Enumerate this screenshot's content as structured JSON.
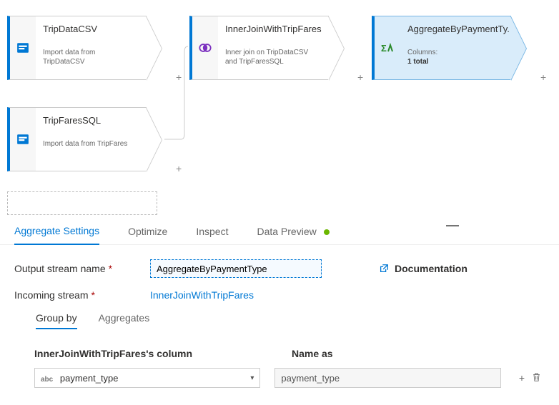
{
  "canvas": {
    "nodes": {
      "n1": {
        "title": "TripDataCSV",
        "sub": "Import data from TripDataCSV"
      },
      "n2": {
        "title": "InnerJoinWithTripFares",
        "sub": "Inner join on TripDataCSV and TripFaresSQL"
      },
      "n3": {
        "title": "AggregateByPaymentTy...",
        "sub_label": "Columns:",
        "sub_count": "1 total"
      },
      "n4": {
        "title": "TripFaresSQL",
        "sub": "Import data from TripFares"
      }
    },
    "plus": "+"
  },
  "tabs": {
    "t1": "Aggregate Settings",
    "t2": "Optimize",
    "t3": "Inspect",
    "t4": "Data Preview"
  },
  "settings": {
    "output_label": "Output stream name",
    "output_value": "AggregateByPaymentType",
    "incoming_label": "Incoming stream",
    "incoming_value": "InnerJoinWithTripFares",
    "doc": "Documentation"
  },
  "subtabs": {
    "s1": "Group by",
    "s2": "Aggregates"
  },
  "columns": {
    "col1_header": "InnerJoinWithTripFares's column",
    "col2_header": "Name as",
    "col1_value": "payment_type",
    "col2_value": "payment_type",
    "type_prefix": "abc"
  },
  "icons": {
    "add": "+",
    "delete": "🗑",
    "ext": "↗",
    "caret": "▾"
  }
}
